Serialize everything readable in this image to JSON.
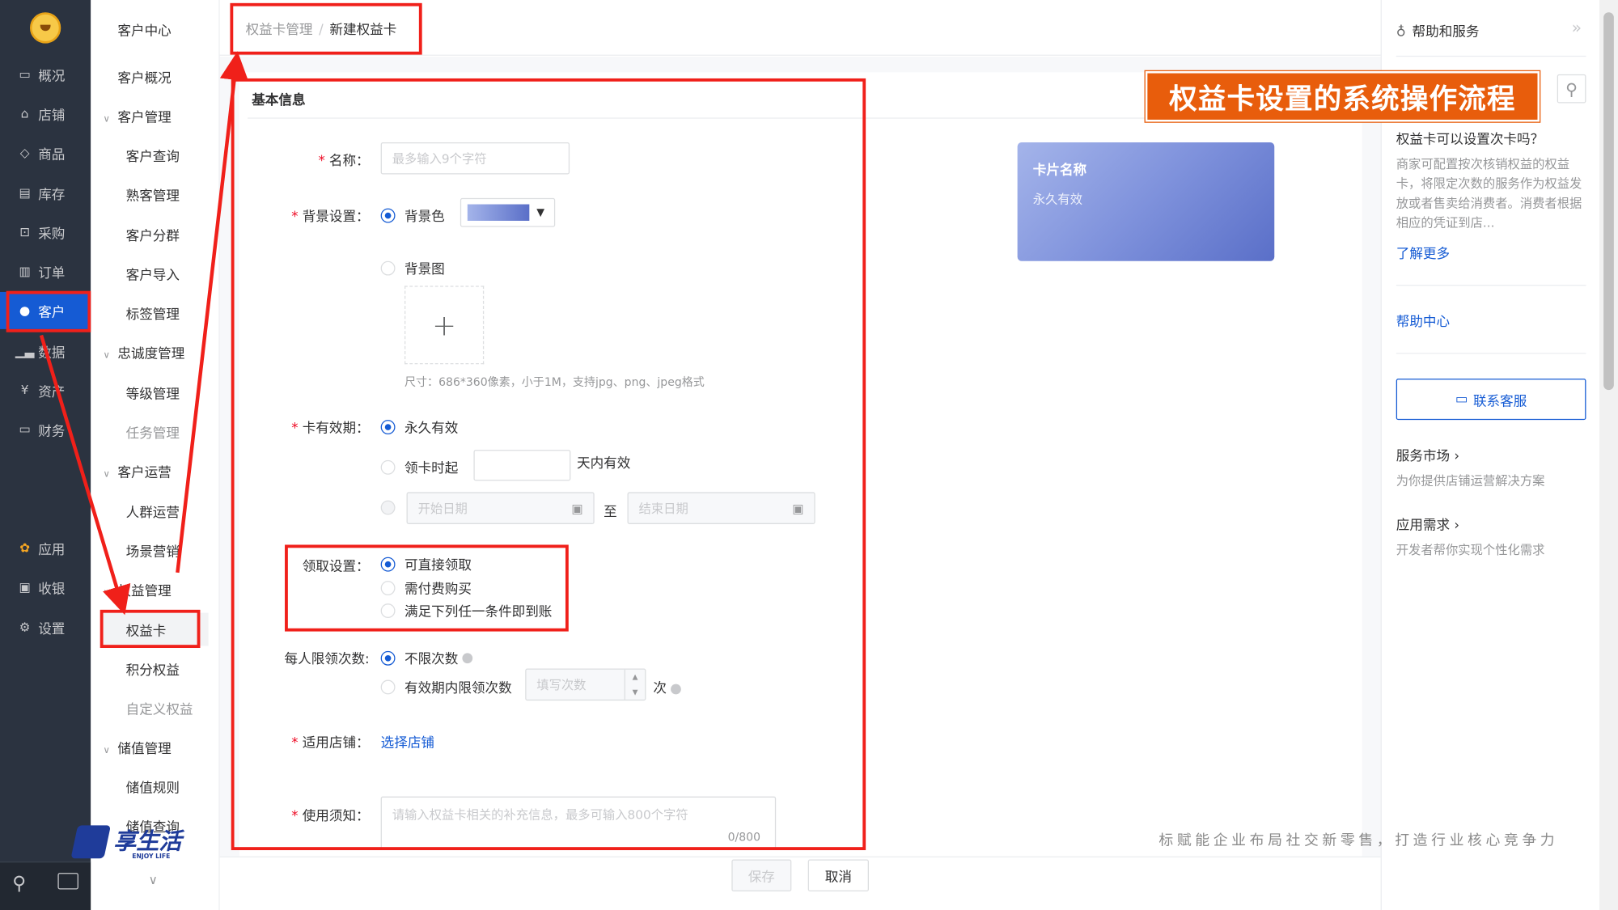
{
  "nav": {
    "items": [
      {
        "label": "概况",
        "icon": "monitor-icon"
      },
      {
        "label": "店铺",
        "icon": "store-icon"
      },
      {
        "label": "商品",
        "icon": "tag-icon"
      },
      {
        "label": "库存",
        "icon": "inventory-icon"
      },
      {
        "label": "采购",
        "icon": "purchase-icon"
      },
      {
        "label": "订单",
        "icon": "order-icon"
      },
      {
        "label": "客户",
        "icon": "user-icon"
      },
      {
        "label": "数据",
        "icon": "bar-chart-icon"
      },
      {
        "label": "资产",
        "icon": "asset-icon"
      },
      {
        "label": "财务",
        "icon": "finance-icon"
      },
      {
        "label": "应用",
        "icon": "apps-icon"
      },
      {
        "label": "收银",
        "icon": "cashier-icon"
      },
      {
        "label": "设置",
        "icon": "gear-icon"
      }
    ]
  },
  "subnav": {
    "title": "客户中心",
    "overview": "客户概况",
    "groups": [
      {
        "label": "客户管理",
        "items": [
          "客户查询",
          "熟客管理",
          "客户分群",
          "客户导入",
          "标签管理"
        ]
      },
      {
        "label": "忠诚度管理",
        "items": [
          "等级管理",
          "任务管理"
        ]
      },
      {
        "label": "客户运营",
        "items": [
          "人群运营",
          "场景营销"
        ]
      },
      {
        "label": "权益管理",
        "items": [
          "权益卡",
          "积分权益",
          "自定义权益"
        ]
      },
      {
        "label": "储值管理",
        "items": [
          "储值规则",
          "储值查询"
        ]
      }
    ]
  },
  "breadcrumb": {
    "parent": "权益卡管理",
    "separator": "/",
    "current": "新建权益卡"
  },
  "form": {
    "section_title": "基本信息",
    "name": {
      "label": "名称：",
      "placeholder": "最多输入9个字符"
    },
    "background": {
      "label": "背景设置：",
      "color_option": "背景色",
      "image_option": "背景图",
      "upload_plus": "+",
      "upload_hint": "尺寸：686*360像素，小于1M，支持jpg、png、jpeg格式"
    },
    "validity": {
      "label": "卡有效期：",
      "forever": "永久有效",
      "from_receive": "领卡时起",
      "days_suffix": "天内有效",
      "start_placeholder": "开始日期",
      "to": "至",
      "end_placeholder": "结束日期"
    },
    "receive": {
      "label": "领取设置：",
      "options": [
        "可直接领取",
        "需付费购买",
        "满足下列任一条件即到账"
      ]
    },
    "limit": {
      "label": "每人限领次数:",
      "unlimited": "不限次数",
      "limited": "有效期内限领次数",
      "count_placeholder": "填写次数",
      "unit": "次"
    },
    "stores": {
      "label": "适用店铺：",
      "link": "选择店铺"
    },
    "notice": {
      "label": "使用须知：",
      "placeholder": "请输入权益卡相关的补充信息，最多可输入800个字符",
      "counter": "0/800"
    }
  },
  "preview": {
    "card_name": "卡片名称",
    "validity": "永久有效"
  },
  "footer": {
    "save": "保存",
    "cancel": "取消"
  },
  "help": {
    "header": "帮助和服务",
    "collapse": "»",
    "question": "权益卡可以设置次卡吗？",
    "answer": "商家可配置按次核销权益的权益卡，将限定次数的服务作为权益发放或者售卖给消费者。消费者根据相应的凭证到店...",
    "learn_more": "了解更多",
    "help_center": "帮助中心",
    "contact": "联系客服",
    "market_title": "服务市场 ›",
    "market_desc": "为你提供店铺运营解决方案",
    "needs_title": "应用需求 ›",
    "needs_desc": "开发者帮你实现个性化需求"
  },
  "overlay": {
    "banner": "权益卡设置的系统操作流程",
    "watermark": "标赋能企业布局社交新零售，打造行业核心竞争力",
    "brand": "享生活",
    "brand_sub": "ENJOY LIFE"
  },
  "colors": {
    "primary": "#155bd4",
    "nav_bg": "#2b3340",
    "annotation_red": "#f0201a",
    "banner_orange": "#e85d0c",
    "card_gradient_start": "#a4b4ea",
    "card_gradient_end": "#5a6fc8"
  }
}
